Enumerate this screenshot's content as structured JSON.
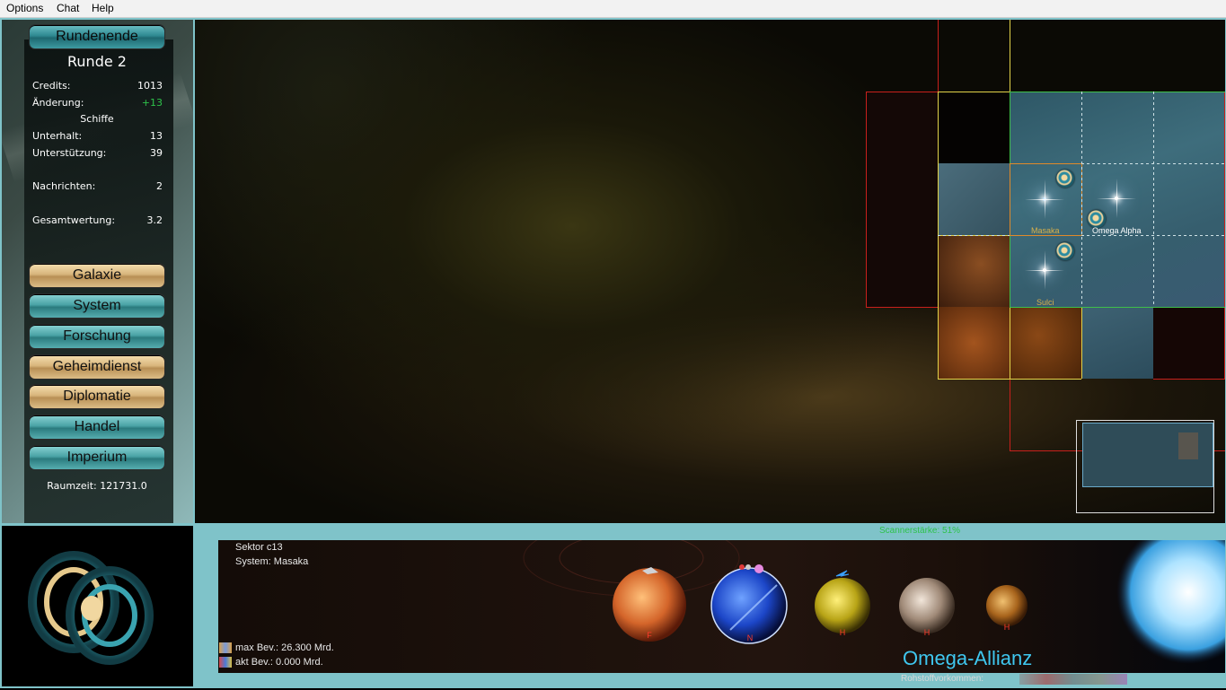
{
  "menu": {
    "items": [
      "Options",
      "Chat",
      "Help"
    ]
  },
  "left_panel": {
    "end_turn_label": "Rundenende",
    "round_label": "Runde 2",
    "stats": {
      "credits_label": "Credits:",
      "credits_value": "1013",
      "change_label": "Änderung:",
      "change_value": "+13",
      "ships_header": "Schiffe",
      "upkeep_label": "Unterhalt:",
      "upkeep_value": "13",
      "support_label": "Unterstützung:",
      "support_value": "39",
      "messages_label": "Nachrichten:",
      "messages_value": "2",
      "score_label": "Gesamtwertung:",
      "score_value": "3.2"
    },
    "nav": [
      "Galaxie",
      "System",
      "Forschung",
      "Geheimdienst",
      "Diplomatie",
      "Handel",
      "Imperium"
    ],
    "spacetime": "Raumzeit: 121731.0"
  },
  "map": {
    "systems": [
      {
        "name": "Masaka",
        "color": "#d9b14a"
      },
      {
        "name": "Omega Alpha",
        "color": "#ffffff"
      },
      {
        "name": "Sulci",
        "color": "#d9b14a"
      }
    ]
  },
  "sector_info": {
    "scanner": "Scannerstärke: 51%",
    "sector": "Sektor c13",
    "system": "System: Masaka",
    "max_pop": "max Bev.: 26.300 Mrd.",
    "cur_pop": "akt Bev.: 0.000 Mrd.",
    "planets": [
      {
        "class": "F"
      },
      {
        "class": "N"
      },
      {
        "class": "H"
      },
      {
        "class": "H"
      },
      {
        "class": "H"
      }
    ],
    "faction": "Omega-Allianz",
    "resources_label": "Rohstoffvorkommen:"
  },
  "colors": {
    "positive": "#2ec24a",
    "faction": "#3fc7ef",
    "planet_class": "#ff3a2a"
  }
}
